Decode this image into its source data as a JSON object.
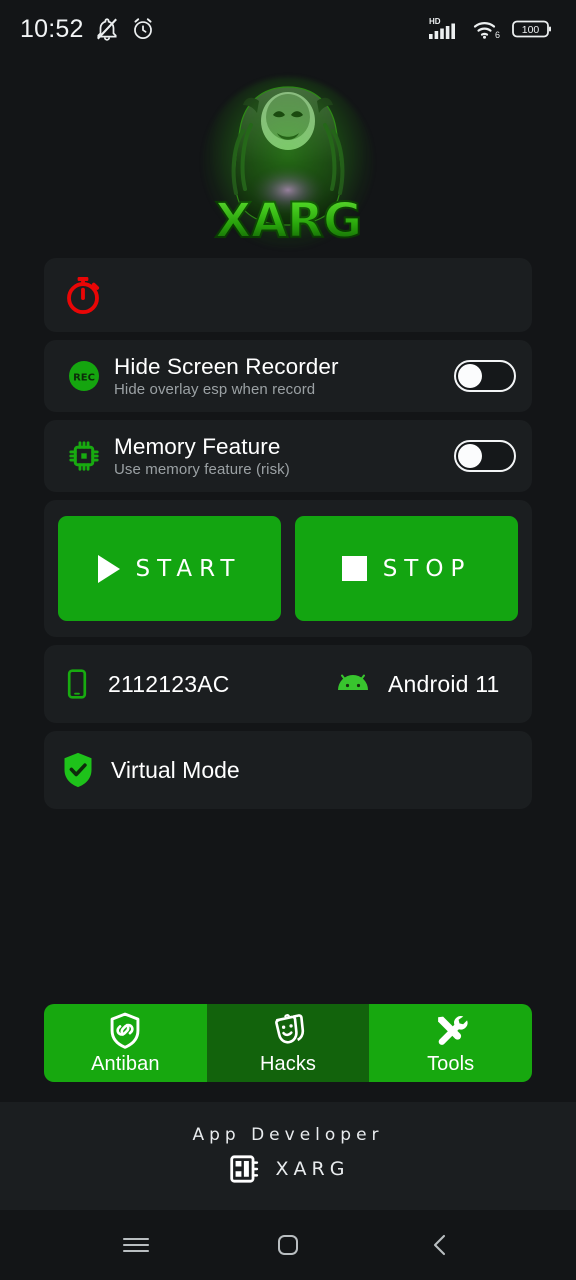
{
  "statusbar": {
    "time": "10:52",
    "icons_left": [
      "bell-mute-icon",
      "alarm-clock-icon"
    ],
    "network_label": "HD",
    "wifi_label": "6",
    "battery_level": "100"
  },
  "logo": {
    "name": "xarg-logo",
    "wordmark": "XARG",
    "glow_color": "#3ad816"
  },
  "timer_card": {
    "icon": "stopwatch-icon",
    "icon_color": "#e90606",
    "value": ""
  },
  "toggles": [
    {
      "icon": "rec-icon",
      "icon_text": "REC",
      "title": "Hide Screen Recorder",
      "subtitle": "Hide overlay esp when record",
      "state": "off"
    },
    {
      "icon": "memory-chip-icon",
      "title": "Memory Feature",
      "subtitle": "Use memory feature (risk)",
      "state": "off"
    }
  ],
  "actions": {
    "start_label": "START",
    "start_icon": "play-icon",
    "stop_label": "STOP",
    "stop_icon": "stop-icon",
    "button_color": "#13a511"
  },
  "device": {
    "phone_icon": "smartphone-icon",
    "model": "2112123AC",
    "os_icon": "android-icon",
    "os_version": "Android 11"
  },
  "virtual_mode": {
    "icon": "shield-check-icon",
    "label": "Virtual Mode"
  },
  "tabs": [
    {
      "label": "Antiban",
      "icon": "shield-link-icon",
      "active": true
    },
    {
      "label": "Hacks",
      "icon": "theater-masks-icon",
      "active": false
    },
    {
      "label": "Tools",
      "icon": "tools-icon",
      "active": true
    }
  ],
  "footer": {
    "title": "App Developer",
    "icon": "chip-icon",
    "name": "XARG"
  },
  "navbar": {
    "recents_icon": "menu-icon",
    "home_icon": "home-square-icon",
    "back_icon": "chevron-left-icon"
  },
  "theme": {
    "bg": "#131517",
    "card_bg": "#1b1e20",
    "green": "#17a80f",
    "green_dim": "#12630c",
    "text": "#ffffff",
    "subtext": "#9ba1a4"
  }
}
